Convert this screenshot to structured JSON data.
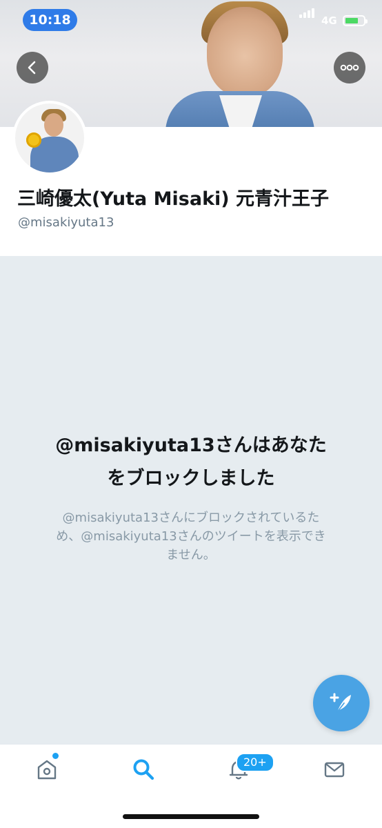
{
  "status_bar": {
    "time": "10:18",
    "network": "4G"
  },
  "profile": {
    "name": "三崎優太(Yuta Misaki) 元青汁王子",
    "handle": "@misakiyuta13"
  },
  "blocked": {
    "title_line1": "@misakiyuta13さんはあなた",
    "title_line2": "をブロックしました",
    "desc_line1": "@misakiyuta13さんにブロックされているた",
    "desc_line2": "め、@misakiyuta13さんのツイートを表示でき",
    "desc_line3": "ません。"
  },
  "tabbar": {
    "notifications_badge": "20+"
  },
  "colors": {
    "accent": "#1da1f2",
    "fab": "#4aa3e4",
    "background": "#e6ecf0"
  },
  "icons": [
    "back-arrow-icon",
    "more-icon",
    "compose-tweet-icon",
    "home-icon",
    "search-icon",
    "notifications-bell-icon",
    "messages-envelope-icon",
    "battery-icon",
    "signal-icon"
  ]
}
